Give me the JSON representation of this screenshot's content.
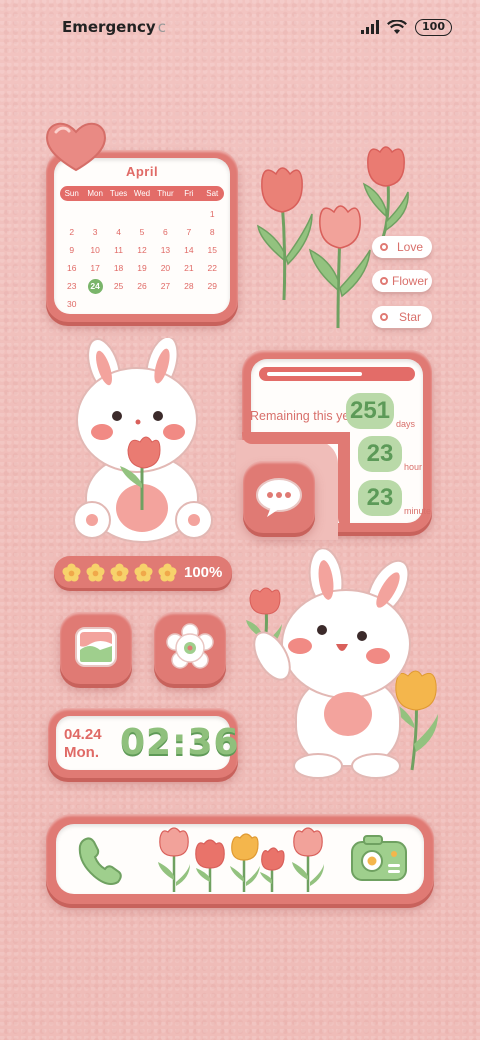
{
  "status_bar": {
    "carrier": "Emergency",
    "carrier_dot": "c",
    "battery": "100"
  },
  "calendar": {
    "month": "April",
    "weekdays": [
      "Sun",
      "Mon",
      "Tues",
      "Wed",
      "Thur",
      "Fri",
      "Sat"
    ],
    "days": [
      "",
      "",
      "",
      "",
      "",
      "",
      "1",
      "2",
      "3",
      "4",
      "5",
      "6",
      "7",
      "8",
      "9",
      "10",
      "11",
      "12",
      "13",
      "14",
      "15",
      "16",
      "17",
      "18",
      "19",
      "20",
      "21",
      "22",
      "23",
      "24",
      "25",
      "26",
      "27",
      "28",
      "29",
      "30"
    ],
    "today": "24"
  },
  "tags": [
    "Love",
    "Flower",
    "Star"
  ],
  "countdown": {
    "label": "Remaining this year",
    "days": {
      "value": "251",
      "unit": "days"
    },
    "hours": {
      "value": "23",
      "unit": "hour"
    },
    "minutes": {
      "value": "23",
      "unit": "minute"
    }
  },
  "progress": {
    "percent": 1.0,
    "label": "100%"
  },
  "clock": {
    "date": "04.24",
    "weekday": "Mon.",
    "time": "02:36"
  },
  "colors": {
    "accent": "#e07a74",
    "green": "#8fc07c",
    "background": "#f0bdb9"
  },
  "icons": [
    "heart-icon",
    "message-icon",
    "gallery-icon",
    "settings-icon",
    "phone-icon",
    "camera-icon"
  ]
}
